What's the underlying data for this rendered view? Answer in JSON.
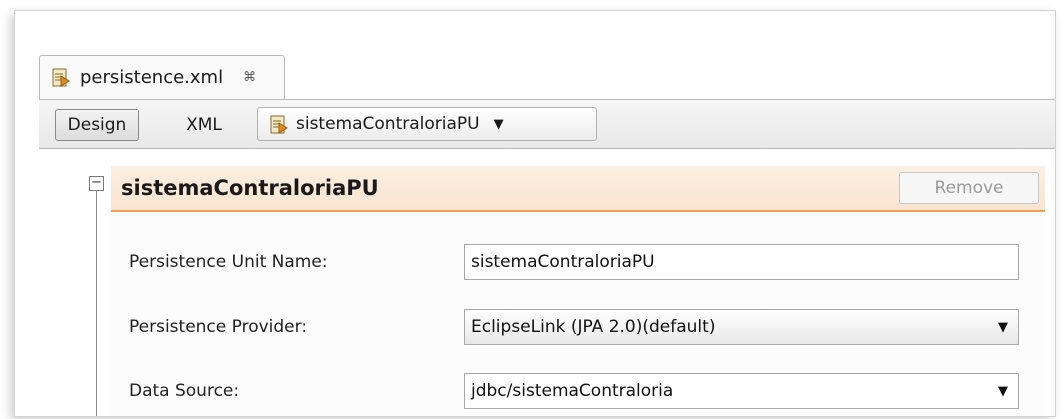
{
  "editor": {
    "tab_title": "persistence.xml",
    "close_glyph": "⌘"
  },
  "toolbar": {
    "design_label": "Design",
    "xml_label": "XML",
    "pu_selector_value": "sistemaContraloriaPU"
  },
  "section": {
    "title": "sistemaContraloriaPU",
    "remove_label": "Remove",
    "collapse_glyph": "−"
  },
  "fields": {
    "unit_name_label": "Persistence Unit Name:",
    "unit_name_value": "sistemaContraloriaPU",
    "provider_label": "Persistence Provider:",
    "provider_value": "EclipseLink (JPA 2.0)(default)",
    "datasource_label": "Data Source:",
    "datasource_value": "jdbc/sistemaContraloria"
  },
  "icons": {
    "file_icon": "persistence-file-icon",
    "caret": "▼"
  },
  "colors": {
    "section_header_bg": "#fcefe2",
    "section_accent": "#f0a050"
  }
}
